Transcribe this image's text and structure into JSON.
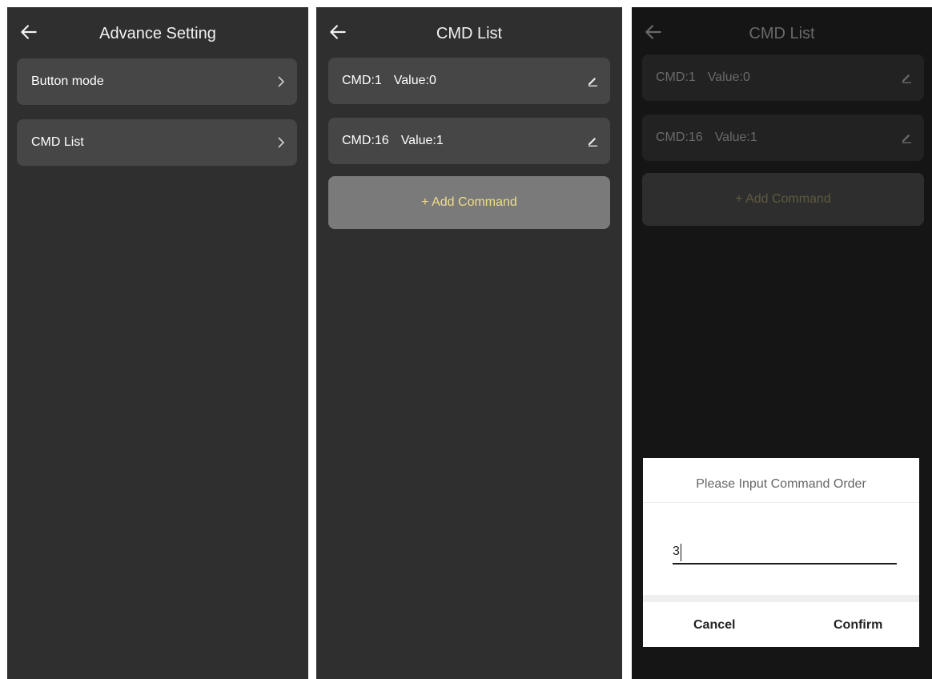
{
  "screens": [
    {
      "title": "Advance Setting",
      "items": [
        {
          "label": "Button mode"
        },
        {
          "label": "CMD List"
        }
      ]
    },
    {
      "title": "CMD List",
      "commands": [
        {
          "cmd": "CMD:1",
          "value": "Value:0"
        },
        {
          "cmd": "CMD:16",
          "value": "Value:1"
        }
      ],
      "add_label": "+ Add Command"
    },
    {
      "title": "CMD List",
      "commands": [
        {
          "cmd": "CMD:1",
          "value": "Value:0"
        },
        {
          "cmd": "CMD:16",
          "value": "Value:1"
        }
      ],
      "add_label": "+ Add Command",
      "dialog": {
        "title": "Please Input Command Order",
        "input_value": "3",
        "cancel_label": "Cancel",
        "confirm_label": "Confirm"
      }
    }
  ],
  "icons": {
    "back": "arrow-left-icon",
    "chevron": "chevron-right-icon",
    "edit": "pencil-icon"
  },
  "colors": {
    "background": "#2f2f2f",
    "row": "#464646",
    "add_button": "#7a7a7a",
    "add_text": "#f0dd88",
    "dim_background": "#151515"
  }
}
